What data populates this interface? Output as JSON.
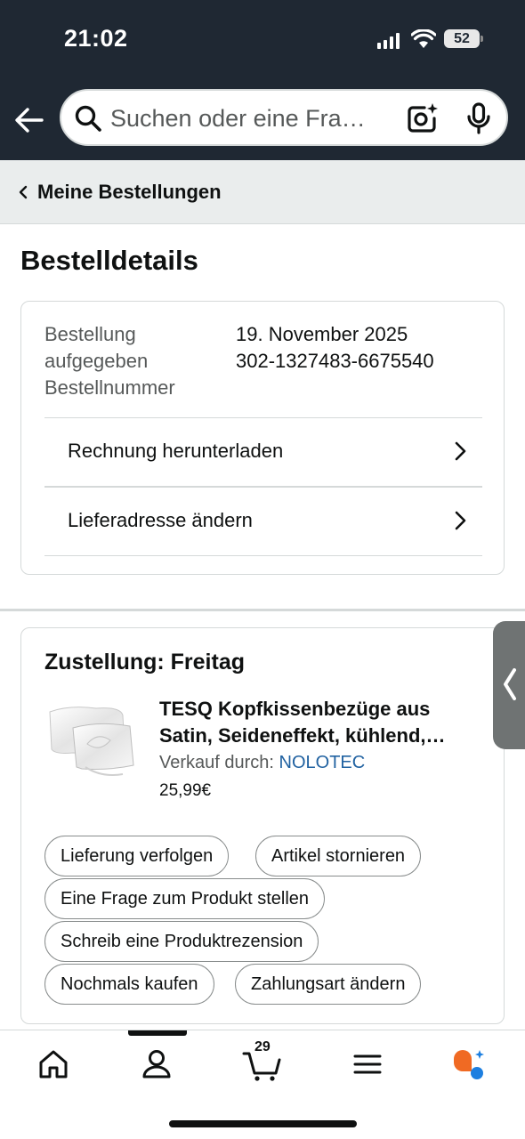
{
  "status_bar": {
    "time": "21:02",
    "battery": "52"
  },
  "search": {
    "placeholder": "Suchen oder eine Fra…"
  },
  "breadcrumb": {
    "label": "Meine Bestellungen"
  },
  "page": {
    "title": "Bestelldetails"
  },
  "order": {
    "labels": [
      "Bestellung",
      "aufgegeben",
      "Bestellnummer"
    ],
    "date": "19. November 2025",
    "number": "302-1327483-6675540",
    "links": [
      {
        "label": "Rechnung herunterladen"
      },
      {
        "label": "Lieferadresse ändern"
      }
    ]
  },
  "delivery": {
    "title": "Zustellung: Freitag",
    "product": {
      "title_lines": [
        "TESQ Kopfkissenbezüge aus",
        "Satin, Seideneffekt, kühlend,…"
      ],
      "seller_prefix": "Verkauf durch:",
      "seller": "NOLOTEC",
      "price": "25,99€"
    },
    "actions": [
      "Lieferung verfolgen",
      "Artikel stornieren",
      "Eine Frage zum Produkt stellen",
      "Schreib eine Produktrezension",
      "Nochmals kaufen",
      "Zahlungsart ändern"
    ]
  },
  "bottom_nav": {
    "items": [
      "home-icon",
      "account-icon",
      "cart-icon",
      "menu-icon",
      "rufus-ai-icon"
    ],
    "cart_count": "29"
  },
  "colors": {
    "header_bg": "#1f2833",
    "link_blue": "#2162a1",
    "ai_orange": "#f06a23",
    "ai_blue": "#1d7fe0"
  }
}
